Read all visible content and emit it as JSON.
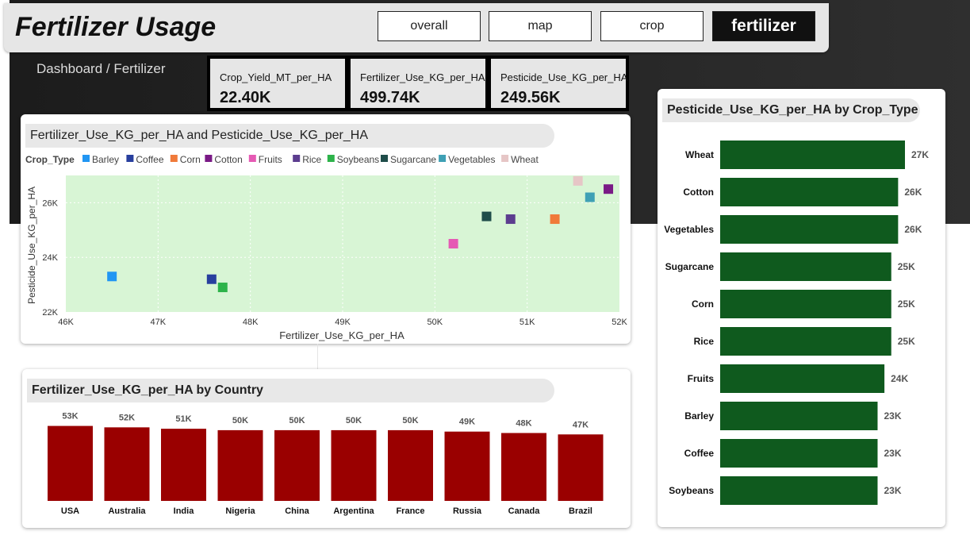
{
  "header": {
    "title": "Fertilizer Usage",
    "nav": [
      {
        "label": "overall",
        "active": false
      },
      {
        "label": "map",
        "active": false
      },
      {
        "label": "crop",
        "active": false
      },
      {
        "label": "fertilizer",
        "active": true
      }
    ]
  },
  "breadcrumb": "Dashboard / Fertilizer",
  "kpis": [
    {
      "label": "Crop_Yield_MT_per_HA",
      "value": "22.40K"
    },
    {
      "label": "Fertilizer_Use_KG_per_HA",
      "value": "499.74K"
    },
    {
      "label": "Pesticide_Use_KG_per_HA",
      "value": "249.56K"
    }
  ],
  "colors": {
    "country_bar": "#9a0000",
    "crop_bar": "#0f5a1e",
    "scatter_bg": "#d8f5d5"
  },
  "chart_data": [
    {
      "type": "scatter",
      "title": "Fertilizer_Use_KG_per_HA and Pesticide_Use_KG_per_HA",
      "legend_title": "Crop_Type",
      "legend_position": "top-left",
      "xlabel": "Fertilizer_Use_KG_per_HA",
      "ylabel": "Pesticide_Use_KG_per_HA",
      "xlim": [
        46000,
        52000
      ],
      "ylim": [
        22000,
        27000
      ],
      "xticks": [
        "46K",
        "47K",
        "48K",
        "49K",
        "50K",
        "51K",
        "52K"
      ],
      "yticks": [
        "22K",
        "24K",
        "26K"
      ],
      "grid": true,
      "series": [
        {
          "name": "Barley",
          "color": "#2196f3",
          "x": 46500,
          "y": 23300
        },
        {
          "name": "Coffee",
          "color": "#283f9e",
          "x": 47580,
          "y": 23200
        },
        {
          "name": "Corn",
          "color": "#f07a3a",
          "x": 51300,
          "y": 25400
        },
        {
          "name": "Cotton",
          "color": "#7a1a86",
          "x": 51880,
          "y": 26500
        },
        {
          "name": "Fruits",
          "color": "#e55ab4",
          "x": 50200,
          "y": 24500
        },
        {
          "name": "Rice",
          "color": "#5c3d8f",
          "x": 50820,
          "y": 25400
        },
        {
          "name": "Soybeans",
          "color": "#2db34a",
          "x": 47700,
          "y": 22900
        },
        {
          "name": "Sugarcane",
          "color": "#1f4d4a",
          "x": 50560,
          "y": 25500
        },
        {
          "name": "Vegetables",
          "color": "#3fa0b5",
          "x": 51680,
          "y": 26200
        },
        {
          "name": "Wheat",
          "color": "#e6c6c6",
          "x": 51550,
          "y": 26800
        }
      ]
    },
    {
      "type": "bar",
      "title": "Fertilizer_Use_KG_per_HA by Country",
      "categories": [
        "USA",
        "Australia",
        "India",
        "Nigeria",
        "China",
        "Argentina",
        "France",
        "Russia",
        "Canada",
        "Brazil"
      ],
      "values": [
        53000,
        52000,
        51000,
        50000,
        50000,
        50000,
        50000,
        49000,
        48000,
        47000
      ],
      "labels": [
        "53K",
        "52K",
        "51K",
        "50K",
        "50K",
        "50K",
        "50K",
        "49K",
        "48K",
        "47K"
      ]
    },
    {
      "type": "bar",
      "orientation": "horizontal",
      "title": "Pesticide_Use_KG_per_HA by Crop_Type",
      "categories": [
        "Wheat",
        "Cotton",
        "Vegetables",
        "Sugarcane",
        "Corn",
        "Rice",
        "Fruits",
        "Barley",
        "Coffee",
        "Soybeans"
      ],
      "values": [
        27000,
        26000,
        26000,
        25000,
        25000,
        25000,
        24000,
        23000,
        23000,
        23000
      ],
      "labels": [
        "27K",
        "26K",
        "26K",
        "25K",
        "25K",
        "25K",
        "24K",
        "23K",
        "23K",
        "23K"
      ]
    }
  ]
}
